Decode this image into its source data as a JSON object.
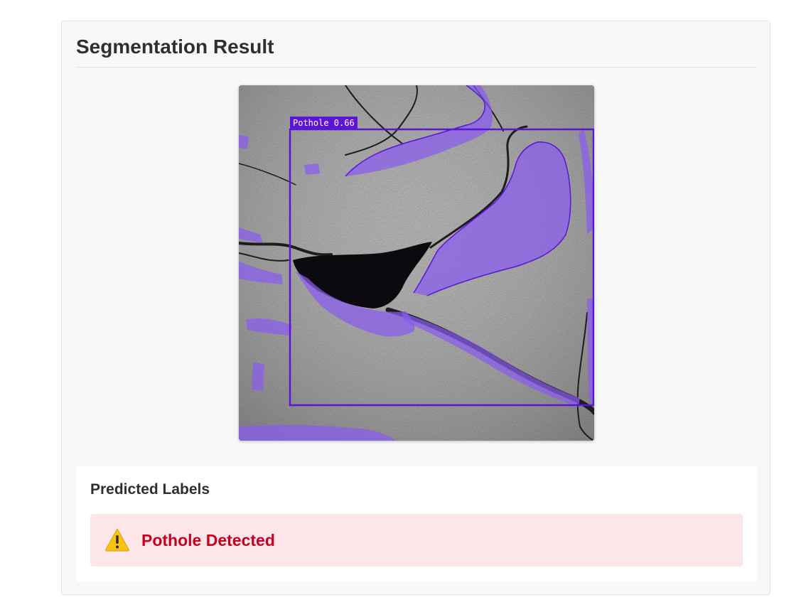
{
  "result": {
    "title": "Segmentation Result"
  },
  "figure": {
    "detection": {
      "class_name": "Pothole",
      "confidence": 0.66,
      "label": "Pothole 0.66",
      "box_color": "#5b14d8",
      "mask_color": "#8a5cf0"
    }
  },
  "predicted": {
    "title": "Predicted Labels",
    "alert_text": "Pothole Detected",
    "alert_icon": "warning-icon",
    "alert_bg": "#fde6ea",
    "alert_color": "#c8001f"
  }
}
